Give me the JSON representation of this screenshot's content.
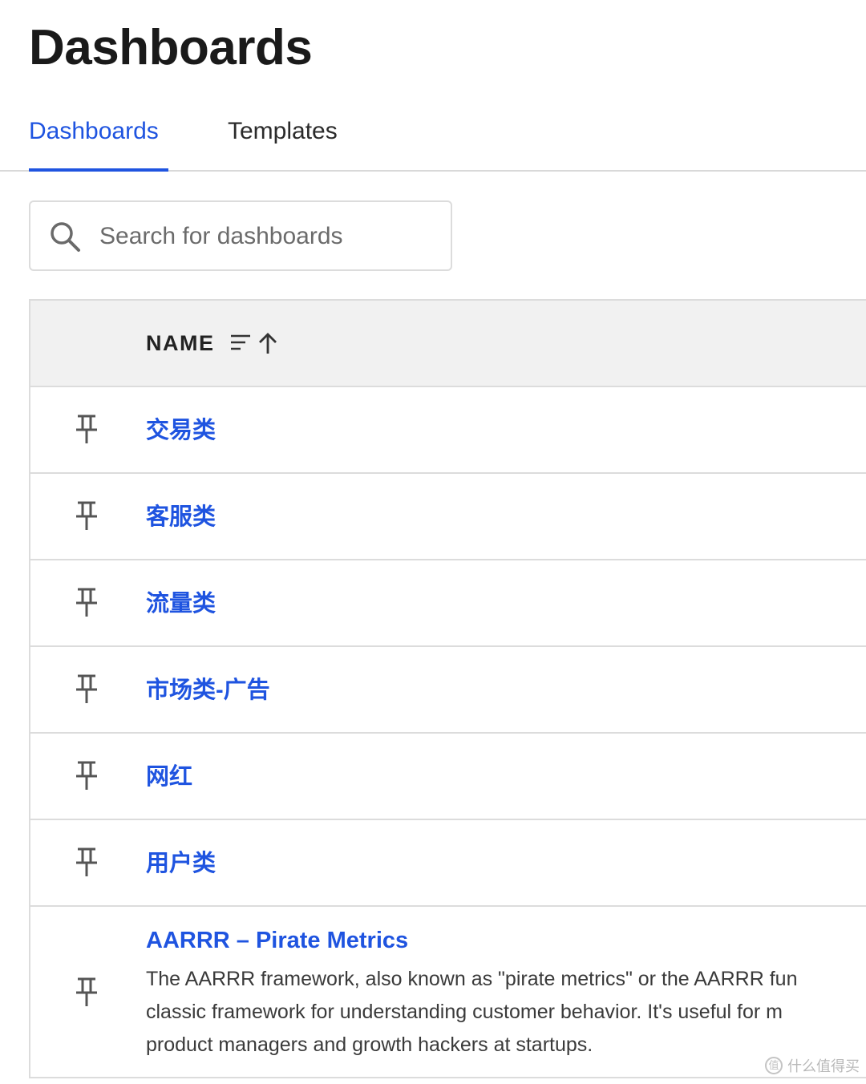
{
  "header": {
    "title": "Dashboards"
  },
  "tabs": [
    {
      "label": "Dashboards",
      "active": true
    },
    {
      "label": "Templates",
      "active": false
    }
  ],
  "search": {
    "placeholder": "Search for dashboards",
    "value": "",
    "icon": "search-icon"
  },
  "table": {
    "columns": [
      {
        "label": "NAME",
        "sort": "ascending",
        "sort_icon": "sort-ascending-icon"
      }
    ],
    "rows": [
      {
        "name": "交易类",
        "pin_icon": "pin-icon"
      },
      {
        "name": "客服类",
        "pin_icon": "pin-icon"
      },
      {
        "name": "流量类",
        "pin_icon": "pin-icon"
      },
      {
        "name": "市场类-广告",
        "pin_icon": "pin-icon"
      },
      {
        "name": "网红",
        "pin_icon": "pin-icon"
      },
      {
        "name": "用户类",
        "pin_icon": "pin-icon"
      },
      {
        "name": "AARRR – Pirate Metrics",
        "pin_icon": "pin-icon",
        "description_lines": [
          "The AARRR framework, also known as \"pirate metrics\" or the AARRR fun",
          "classic framework for understanding customer behavior. It's useful for m",
          "product managers and growth hackers at startups."
        ]
      }
    ]
  },
  "watermark": {
    "text": "什么值得买",
    "icon": "zhi-icon",
    "icon_glyph": "值"
  },
  "colors": {
    "accent": "#1f54e0",
    "header_bg": "#f1f1f1",
    "border": "#dcdcdc"
  }
}
